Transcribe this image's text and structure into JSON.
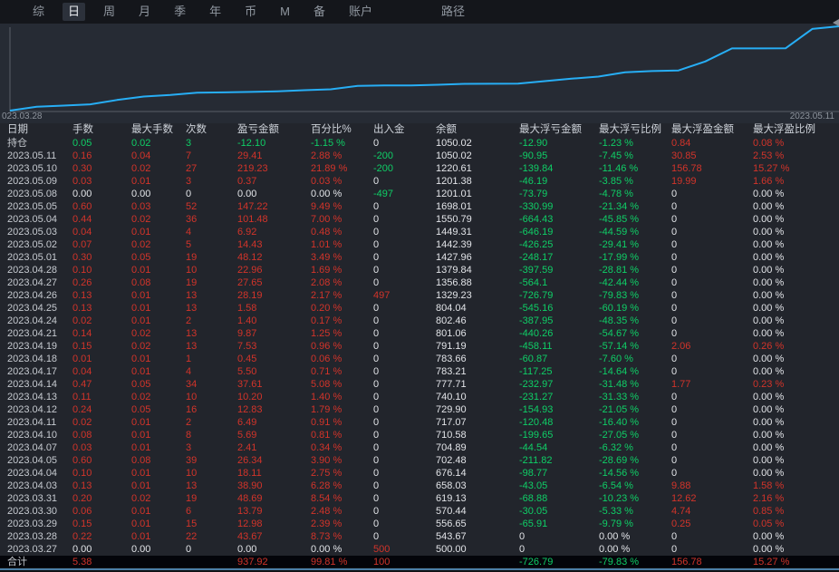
{
  "menu": {
    "items": [
      {
        "label": "综",
        "active": false
      },
      {
        "label": "日",
        "active": true
      },
      {
        "label": "周",
        "active": false
      },
      {
        "label": "月",
        "active": false
      },
      {
        "label": "季",
        "active": false
      },
      {
        "label": "年",
        "active": false
      },
      {
        "label": "币",
        "active": false
      },
      {
        "label": "M",
        "active": false
      },
      {
        "label": "备",
        "active": false
      },
      {
        "label": "账户",
        "active": false
      },
      {
        "label": "路径",
        "active": false,
        "gap_before": true
      }
    ]
  },
  "chart_data": {
    "type": "line",
    "title": "",
    "xlabel": "",
    "ylabel": "",
    "legend": [],
    "grid": false,
    "x_left_label": "023.03.28",
    "x_right_label": "2023.05.11",
    "line_color": "#27aef5",
    "ylim": [
      0,
      950
    ],
    "x": [
      "2023.03.27",
      "2023.03.28",
      "2023.03.29",
      "2023.03.30",
      "2023.03.31",
      "2023.04.03",
      "2023.04.04",
      "2023.04.05",
      "2023.04.07",
      "2023.04.10",
      "2023.04.11",
      "2023.04.12",
      "2023.04.13",
      "2023.04.14",
      "2023.04.17",
      "2023.04.18",
      "2023.04.19",
      "2023.04.21",
      "2023.04.24",
      "2023.04.25",
      "2023.04.26",
      "2023.04.27",
      "2023.04.28",
      "2023.05.01",
      "2023.05.02",
      "2023.05.03",
      "2023.05.04",
      "2023.05.05",
      "2023.05.08",
      "2023.05.09",
      "2023.05.10",
      "2023.05.11"
    ],
    "values": [
      0,
      43.67,
      56.65,
      70.44,
      119.13,
      158.03,
      176.14,
      202.48,
      204.89,
      210.58,
      217.07,
      229.9,
      240.1,
      277.71,
      283.21,
      283.66,
      291.19,
      301.06,
      302.46,
      304.04,
      332.23,
      359.88,
      382.84,
      430.96,
      445.39,
      452.31,
      553.79,
      701.01,
      701.01,
      701.38,
      920.61,
      950.02
    ]
  },
  "table": {
    "headers": [
      "日期",
      "手数",
      "最大手数",
      "次数",
      "盈亏金额",
      "百分比%",
      "出入金",
      "余额",
      "最大浮亏金额",
      "最大浮亏比例",
      "最大浮盈金额",
      "最大浮盈比例"
    ],
    "rows": [
      {
        "cells": [
          "持仓",
          "0.05",
          "0.02",
          "3",
          "-12.10",
          "-1.15 %",
          "0",
          "1050.02",
          "-12.90",
          "-1.23 %",
          "0.84",
          "0.08 %"
        ],
        "pos_green": true
      },
      {
        "cells": [
          "2023.05.11",
          "0.16",
          "0.04",
          "7",
          "29.41",
          "2.88 %",
          "-200",
          "1050.02",
          "-90.95",
          "-7.45 %",
          "30.85",
          "2.53 %"
        ]
      },
      {
        "cells": [
          "2023.05.10",
          "0.30",
          "0.02",
          "27",
          "219.23",
          "21.89 %",
          "-200",
          "1220.61",
          "-139.84",
          "-11.46 %",
          "156.78",
          "15.27 %"
        ]
      },
      {
        "cells": [
          "2023.05.09",
          "0.03",
          "0.01",
          "3",
          "0.37",
          "0.03 %",
          "0",
          "1201.38",
          "-46.19",
          "-3.85 %",
          "19.99",
          "1.66 %"
        ]
      },
      {
        "cells": [
          "2023.05.08",
          "0.00",
          "0.00",
          "0",
          "0.00",
          "0.00 %",
          "-497",
          "1201.01",
          "-73.79",
          "-4.78 %",
          "0",
          "0.00 %"
        ]
      },
      {
        "cells": [
          "2023.05.05",
          "0.60",
          "0.03",
          "52",
          "147.22",
          "9.49 %",
          "0",
          "1698.01",
          "-330.99",
          "-21.34 %",
          "0",
          "0.00 %"
        ]
      },
      {
        "cells": [
          "2023.05.04",
          "0.44",
          "0.02",
          "36",
          "101.48",
          "7.00 %",
          "0",
          "1550.79",
          "-664.43",
          "-45.85 %",
          "0",
          "0.00 %"
        ]
      },
      {
        "cells": [
          "2023.05.03",
          "0.04",
          "0.01",
          "4",
          "6.92",
          "0.48 %",
          "0",
          "1449.31",
          "-646.19",
          "-44.59 %",
          "0",
          "0.00 %"
        ]
      },
      {
        "cells": [
          "2023.05.02",
          "0.07",
          "0.02",
          "5",
          "14.43",
          "1.01 %",
          "0",
          "1442.39",
          "-426.25",
          "-29.41 %",
          "0",
          "0.00 %"
        ]
      },
      {
        "cells": [
          "2023.05.01",
          "0.30",
          "0.05",
          "19",
          "48.12",
          "3.49 %",
          "0",
          "1427.96",
          "-248.17",
          "-17.99 %",
          "0",
          "0.00 %"
        ]
      },
      {
        "cells": [
          "2023.04.28",
          "0.10",
          "0.01",
          "10",
          "22.96",
          "1.69 %",
          "0",
          "1379.84",
          "-397.59",
          "-28.81 %",
          "0",
          "0.00 %"
        ]
      },
      {
        "cells": [
          "2023.04.27",
          "0.26",
          "0.08",
          "19",
          "27.65",
          "2.08 %",
          "0",
          "1356.88",
          "-564.1",
          "-42.44 %",
          "0",
          "0.00 %"
        ]
      },
      {
        "cells": [
          "2023.04.26",
          "0.13",
          "0.01",
          "13",
          "28.19",
          "2.17 %",
          "497",
          "1329.23",
          "-726.79",
          "-79.83 %",
          "0",
          "0.00 %"
        ]
      },
      {
        "cells": [
          "2023.04.25",
          "0.13",
          "0.01",
          "13",
          "1.58",
          "0.20 %",
          "0",
          "804.04",
          "-545.16",
          "-60.19 %",
          "0",
          "0.00 %"
        ]
      },
      {
        "cells": [
          "2023.04.24",
          "0.02",
          "0.01",
          "2",
          "1.40",
          "0.17 %",
          "0",
          "802.46",
          "-387.95",
          "-48.35 %",
          "0",
          "0.00 %"
        ]
      },
      {
        "cells": [
          "2023.04.21",
          "0.14",
          "0.02",
          "13",
          "9.87",
          "1.25 %",
          "0",
          "801.06",
          "-440.26",
          "-54.67 %",
          "0",
          "0.00 %"
        ]
      },
      {
        "cells": [
          "2023.04.19",
          "0.15",
          "0.02",
          "13",
          "7.53",
          "0.96 %",
          "0",
          "791.19",
          "-458.11",
          "-57.14 %",
          "2.06",
          "0.26 %"
        ]
      },
      {
        "cells": [
          "2023.04.18",
          "0.01",
          "0.01",
          "1",
          "0.45",
          "0.06 %",
          "0",
          "783.66",
          "-60.87",
          "-7.60 %",
          "0",
          "0.00 %"
        ]
      },
      {
        "cells": [
          "2023.04.17",
          "0.04",
          "0.01",
          "4",
          "5.50",
          "0.71 %",
          "0",
          "783.21",
          "-117.25",
          "-14.64 %",
          "0",
          "0.00 %"
        ]
      },
      {
        "cells": [
          "2023.04.14",
          "0.47",
          "0.05",
          "34",
          "37.61",
          "5.08 %",
          "0",
          "777.71",
          "-232.97",
          "-31.48 %",
          "1.77",
          "0.23 %"
        ]
      },
      {
        "cells": [
          "2023.04.13",
          "0.11",
          "0.02",
          "10",
          "10.20",
          "1.40 %",
          "0",
          "740.10",
          "-231.27",
          "-31.33 %",
          "0",
          "0.00 %"
        ]
      },
      {
        "cells": [
          "2023.04.12",
          "0.24",
          "0.05",
          "16",
          "12.83",
          "1.79 %",
          "0",
          "729.90",
          "-154.93",
          "-21.05 %",
          "0",
          "0.00 %"
        ]
      },
      {
        "cells": [
          "2023.04.11",
          "0.02",
          "0.01",
          "2",
          "6.49",
          "0.91 %",
          "0",
          "717.07",
          "-120.48",
          "-16.40 %",
          "0",
          "0.00 %"
        ]
      },
      {
        "cells": [
          "2023.04.10",
          "0.08",
          "0.01",
          "8",
          "5.69",
          "0.81 %",
          "0",
          "710.58",
          "-199.65",
          "-27.05 %",
          "0",
          "0.00 %"
        ]
      },
      {
        "cells": [
          "2023.04.07",
          "0.03",
          "0.01",
          "3",
          "2.41",
          "0.34 %",
          "0",
          "704.89",
          "-44.54",
          "-6.32 %",
          "0",
          "0.00 %"
        ]
      },
      {
        "cells": [
          "2023.04.05",
          "0.60",
          "0.08",
          "39",
          "26.34",
          "3.90 %",
          "0",
          "702.48",
          "-211.82",
          "-28.69 %",
          "0",
          "0.00 %"
        ]
      },
      {
        "cells": [
          "2023.04.04",
          "0.10",
          "0.01",
          "10",
          "18.11",
          "2.75 %",
          "0",
          "676.14",
          "-98.77",
          "-14.56 %",
          "0",
          "0.00 %"
        ]
      },
      {
        "cells": [
          "2023.04.03",
          "0.13",
          "0.01",
          "13",
          "38.90",
          "6.28 %",
          "0",
          "658.03",
          "-43.05",
          "-6.54 %",
          "9.88",
          "1.58 %"
        ]
      },
      {
        "cells": [
          "2023.03.31",
          "0.20",
          "0.02",
          "19",
          "48.69",
          "8.54 %",
          "0",
          "619.13",
          "-68.88",
          "-10.23 %",
          "12.62",
          "2.16 %"
        ]
      },
      {
        "cells": [
          "2023.03.30",
          "0.06",
          "0.01",
          "6",
          "13.79",
          "2.48 %",
          "0",
          "570.44",
          "-30.05",
          "-5.33 %",
          "4.74",
          "0.85 %"
        ]
      },
      {
        "cells": [
          "2023.03.29",
          "0.15",
          "0.01",
          "15",
          "12.98",
          "2.39 %",
          "0",
          "556.65",
          "-65.91",
          "-9.79 %",
          "0.25",
          "0.05 %"
        ]
      },
      {
        "cells": [
          "2023.03.28",
          "0.22",
          "0.01",
          "22",
          "43.67",
          "8.73 %",
          "0",
          "543.67",
          "0",
          "0.00 %",
          "0",
          "0.00 %"
        ]
      },
      {
        "cells": [
          "2023.03.27",
          "0.00",
          "0.00",
          "0",
          "0.00",
          "0.00 %",
          "500",
          "500.00",
          "0",
          "0.00 %",
          "0",
          "0.00 %"
        ]
      },
      {
        "cells": [
          "合计",
          "5.38",
          "",
          "",
          "937.92",
          "99.81 %",
          "100",
          "",
          "-726.79",
          "-79.83 %",
          "156.78",
          "15.27 %"
        ],
        "total": true
      }
    ]
  },
  "colors": {
    "profit_red": "#d2342a",
    "loss_green": "#0fce66",
    "neutral_text": "#e2e4e8",
    "equity_line": "#27aef5",
    "bottom_accent": "#4b7fa6",
    "chart_bg": "#262b34",
    "table_bg": "#22252c",
    "menubar_bg": "#14161b"
  }
}
